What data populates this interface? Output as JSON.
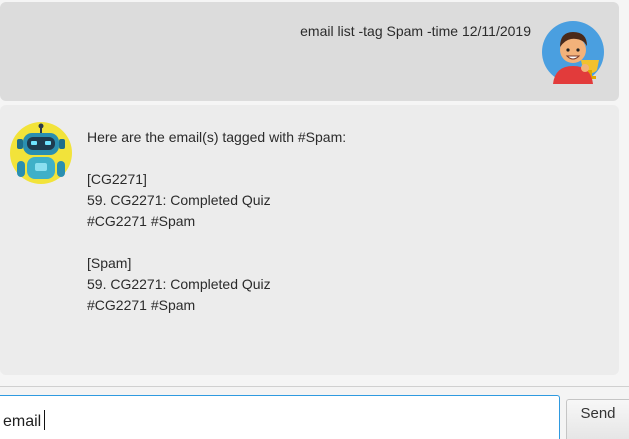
{
  "chat": {
    "user_message": "email list -tag Spam -time 12/11/2019",
    "bot_message": "Here are the email(s) tagged with #Spam:\n\n[CG2271]\n59. CG2271: Completed Quiz\n #CG2271 #Spam\n\n[Spam]\n59. CG2271: Completed Quiz\n #CG2271 #Spam"
  },
  "input": {
    "value": "email"
  },
  "send_button": {
    "label": "Send"
  },
  "icons": {
    "user_avatar": "boy-with-trophy-avatar",
    "bot_avatar": "robot-avatar"
  },
  "colors": {
    "user_bubble": "#dcdcdc",
    "bot_bubble": "#ececec",
    "input_border": "#2f9ae0"
  }
}
